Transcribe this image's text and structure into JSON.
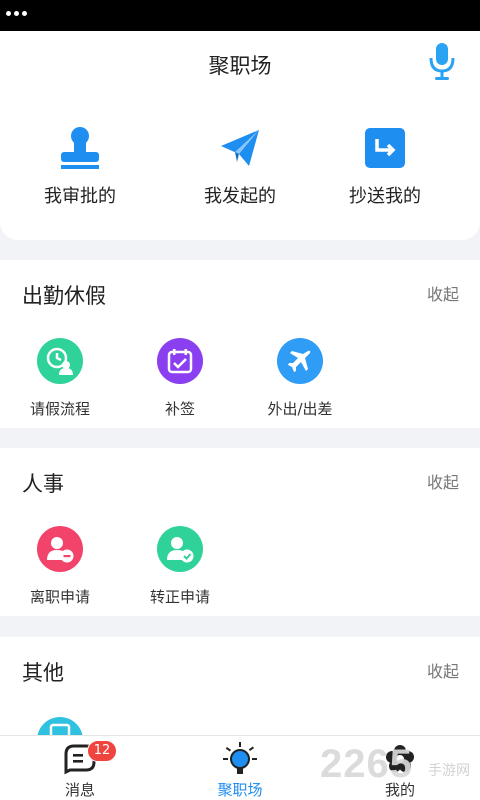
{
  "header": {
    "title": "聚职场"
  },
  "quick_actions": [
    {
      "label": "我审批的"
    },
    {
      "label": "我发起的"
    },
    {
      "label": "抄送我的"
    }
  ],
  "sections": [
    {
      "title": "出勤休假",
      "collapse_label": "收起",
      "items": [
        {
          "label": "请假流程",
          "color": "#2fd39a"
        },
        {
          "label": "补签",
          "color": "#8a3ff0"
        },
        {
          "label": "外出/出差",
          "color": "#2f9cf5"
        }
      ]
    },
    {
      "title": "人事",
      "collapse_label": "收起",
      "items": [
        {
          "label": "离职申请",
          "color": "#f2446a"
        },
        {
          "label": "转正申请",
          "color": "#2fd39a"
        }
      ]
    },
    {
      "title": "其他",
      "collapse_label": "收起",
      "items": []
    }
  ],
  "tabbar": {
    "tabs": [
      {
        "label": "消息",
        "badge": "12"
      },
      {
        "label": "聚职场",
        "active": true
      },
      {
        "label": "我的"
      }
    ]
  },
  "watermark": {
    "number": "2265",
    "text": "手游网"
  },
  "colors": {
    "accent": "#1f8ef1",
    "badge": "#f0443e",
    "background": "#f2f3f7"
  }
}
